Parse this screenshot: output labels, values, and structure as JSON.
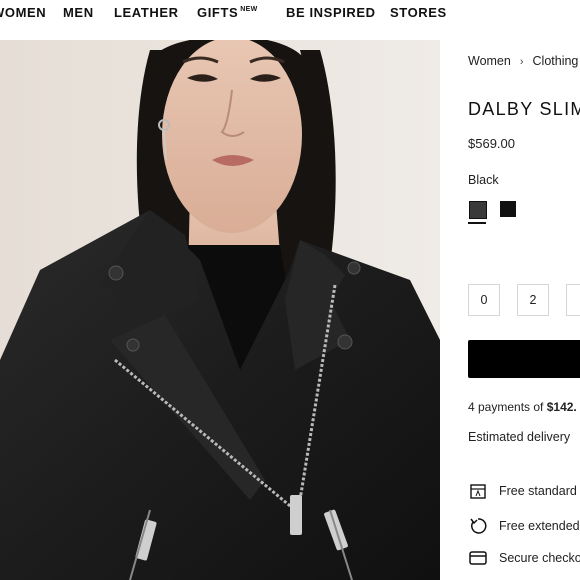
{
  "nav": {
    "items": [
      {
        "label": "WOMEN"
      },
      {
        "label": "MEN"
      },
      {
        "label": "LEATHER"
      },
      {
        "label": "GIFTS",
        "badge": "NEW"
      },
      {
        "label": "BE INSPIRED"
      },
      {
        "label": "STORES"
      }
    ]
  },
  "breadcrumb": [
    "Women",
    "Clothing"
  ],
  "product": {
    "title": "DALBY SLIM",
    "price": "$569.00",
    "color_name": "Black",
    "swatch_colors": [
      "#3a3a3a",
      "#111111"
    ]
  },
  "quantity_options": [
    "0",
    "2"
  ],
  "payments": {
    "prefix": "4 payments of ",
    "amount": "$142."
  },
  "delivery": "Estimated delivery",
  "features": [
    {
      "icon": "shipping-box-icon",
      "label": "Free standard"
    },
    {
      "icon": "return-arrow-icon",
      "label": "Free extended"
    },
    {
      "icon": "credit-card-icon",
      "label": "Secure checko"
    }
  ],
  "colors": {
    "accent": "#000000",
    "text": "#1a1a1a",
    "border": "#d6d6d6"
  }
}
